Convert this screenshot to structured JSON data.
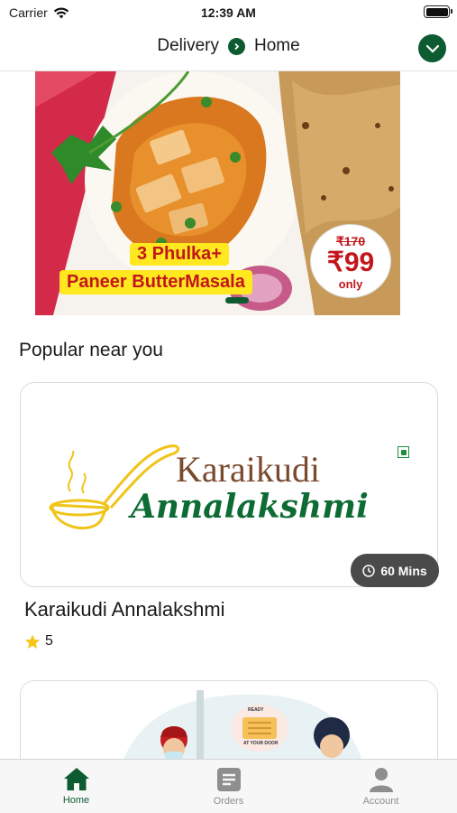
{
  "status_bar": {
    "carrier": "Carrier",
    "time": "12:39 AM"
  },
  "header": {
    "mode": "Delivery",
    "location": "Home"
  },
  "banner": {
    "line1": "3 Phulka+",
    "line2": "Paneer ButterMasala",
    "price_old": "₹170",
    "price_new": "₹99",
    "price_note": "only"
  },
  "section": {
    "title": "Popular near you"
  },
  "restaurants": [
    {
      "logo_line1": "Karaikudi",
      "logo_line2": "Annalakshmi",
      "delivery_time": "60 Mins",
      "name": "Karaikudi Annalakshmi",
      "rating": "5"
    },
    {
      "badge_top": "READY",
      "badge_bottom": "AT YOUR DOOR"
    }
  ],
  "tabs": [
    {
      "label": "Home",
      "icon": "home-icon",
      "active": true
    },
    {
      "label": "Orders",
      "icon": "orders-icon",
      "active": false
    },
    {
      "label": "Account",
      "icon": "account-icon",
      "active": false
    }
  ],
  "colors": {
    "brand_green": "#0d5c31",
    "promo_red": "#c3161c",
    "promo_yellow": "#ffe81f",
    "star": "#f5c518"
  }
}
